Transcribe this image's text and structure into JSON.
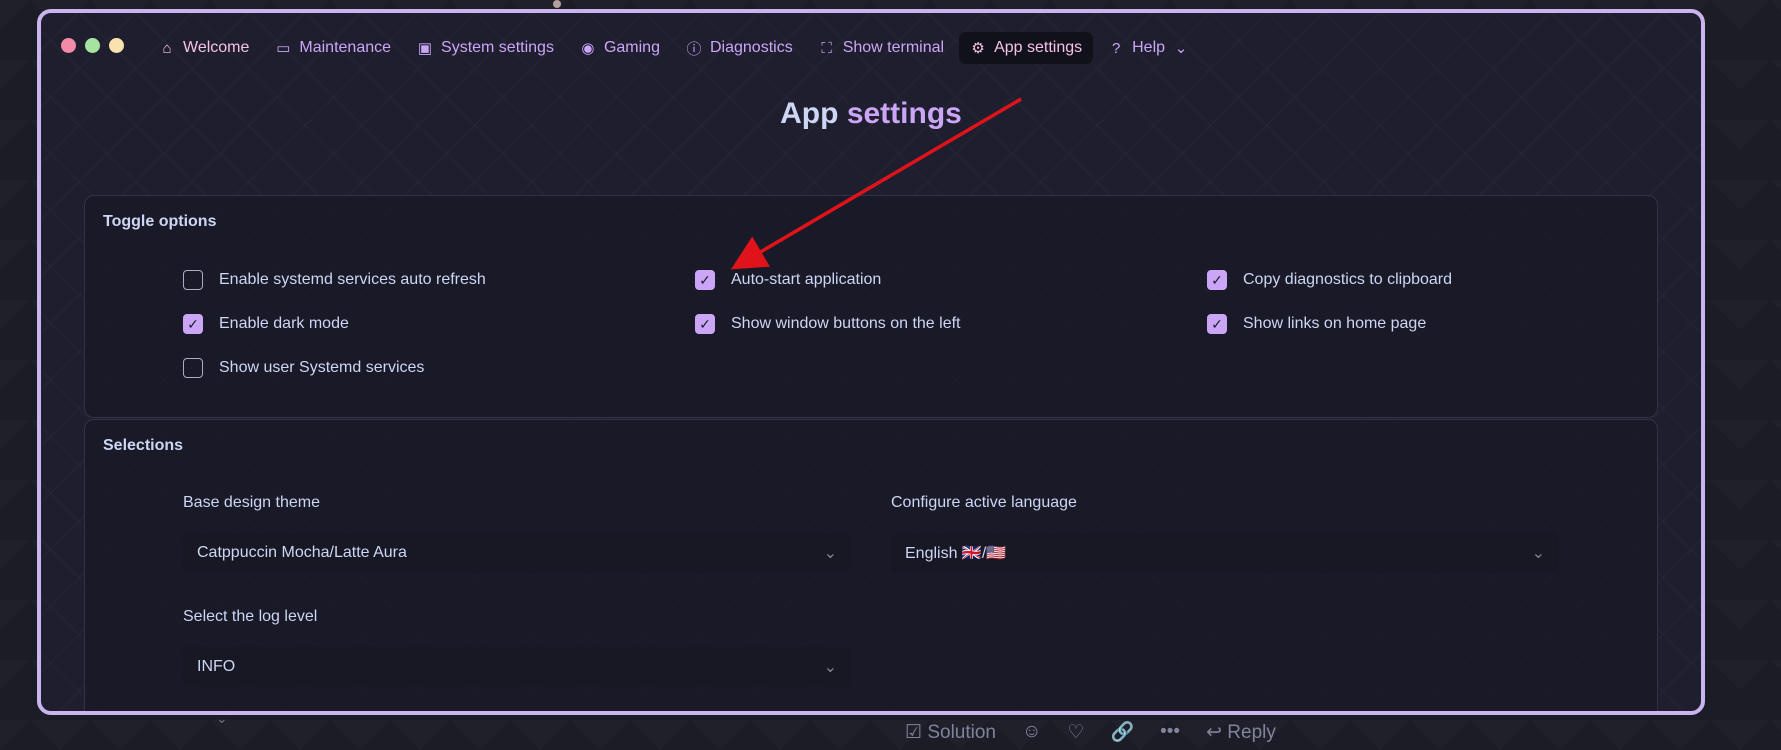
{
  "tabs": [
    {
      "label": "Welcome",
      "icon": "home-icon"
    },
    {
      "label": "Maintenance",
      "icon": "monitor-icon"
    },
    {
      "label": "System settings",
      "icon": "cpu-icon"
    },
    {
      "label": "Gaming",
      "icon": "play-circle-icon"
    },
    {
      "label": "Diagnostics",
      "icon": "info-icon"
    },
    {
      "label": "Show terminal",
      "icon": "fullscreen-icon"
    },
    {
      "label": "App settings",
      "icon": "gear-icon"
    },
    {
      "label": "Help",
      "icon": "help-circle-icon"
    }
  ],
  "title": {
    "part1": "App",
    "part2": "settings"
  },
  "toggle_options": {
    "heading": "Toggle options",
    "items": [
      {
        "label": "Enable systemd services auto refresh",
        "checked": false
      },
      {
        "label": "Auto-start application",
        "checked": true
      },
      {
        "label": "Copy diagnostics to clipboard",
        "checked": true
      },
      {
        "label": "Enable dark mode",
        "checked": true
      },
      {
        "label": "Show window buttons on the left",
        "checked": true
      },
      {
        "label": "Show links on home page",
        "checked": true
      },
      {
        "label": "Show user Systemd services",
        "checked": false
      }
    ]
  },
  "selections": {
    "heading": "Selections",
    "theme": {
      "label": "Base design theme",
      "value": "Catppuccin Mocha/Latte Aura"
    },
    "language": {
      "label": "Configure active language",
      "value": "English 🇬🇧/🇺🇸"
    },
    "log_level": {
      "label": "Select the log level",
      "value": "INFO"
    }
  },
  "bottom": {
    "solution": "Solution",
    "reply": "Reply"
  },
  "colors": {
    "accent": "#cba6f7",
    "border": "#c9b4f0",
    "arrow": "#e0131a"
  }
}
